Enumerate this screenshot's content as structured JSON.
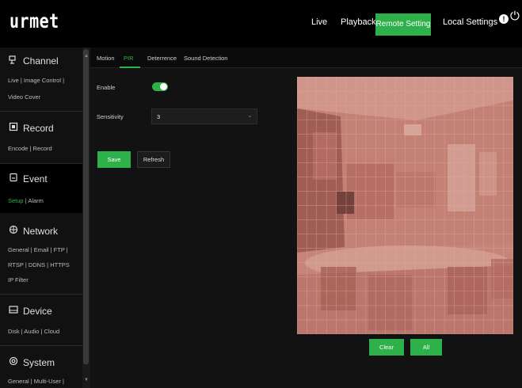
{
  "app": {
    "logo": "urmet"
  },
  "topnav": {
    "live": "Live",
    "playback": "Playback",
    "remote_setting": "Remote Setting",
    "local_settings": "Local Settings",
    "info_glyph": "!",
    "power_glyph": "⏻"
  },
  "sidebar": {
    "channel": {
      "title": "Channel",
      "icon": "camera-icon",
      "links": [
        "Live | Image Control |",
        "Video Cover"
      ]
    },
    "record": {
      "title": "Record",
      "icon": "record-icon",
      "links": [
        "Encode | Record"
      ]
    },
    "event": {
      "title": "Event",
      "icon": "event-icon",
      "links_active": "Setup",
      "links_rest": "| Alarm"
    },
    "network": {
      "title": "Network",
      "icon": "network-icon",
      "links": [
        "General | Email | FTP |",
        "RTSP | DDNS | HTTPS",
        "IP Filter"
      ]
    },
    "device": {
      "title": "Device",
      "icon": "device-icon",
      "links": [
        "Disk | Audio | Cloud"
      ]
    },
    "system": {
      "title": "System",
      "icon": "system-icon",
      "links": [
        "General | Multi-User |"
      ]
    }
  },
  "tabs": [
    "Motion",
    "PIR",
    "Deterrence",
    "Sound Detection"
  ],
  "active_tab": "PIR",
  "form": {
    "enable_label": "Enable",
    "enable_on": true,
    "sensitivity_label": "Sensitivity",
    "sensitivity_value": "3",
    "save_label": "Save",
    "refresh_label": "Refresh"
  },
  "preview": {
    "clear_label": "Clear",
    "all_label": "All"
  },
  "colors": {
    "accent": "#2eb14b",
    "overlay": "#c4776c"
  }
}
